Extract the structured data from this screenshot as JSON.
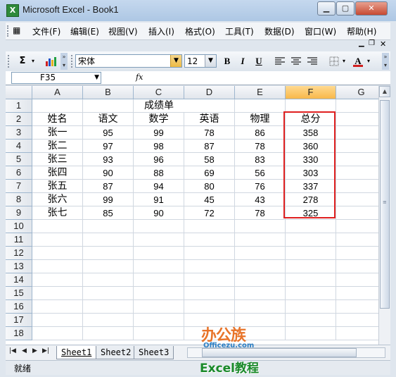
{
  "window": {
    "title": "Microsoft Excel - Book1"
  },
  "menu": [
    "文件(F)",
    "编辑(E)",
    "视图(V)",
    "插入(I)",
    "格式(O)",
    "工具(T)",
    "数据(D)",
    "窗口(W)",
    "帮助(H)"
  ],
  "toolbar": {
    "sum_symbol": "Σ",
    "font_name": "宋体",
    "font_size": "12",
    "bold": "B",
    "italic": "I",
    "underline": "U",
    "font_color_label": "A",
    "font_color": "#d11f1f"
  },
  "formula_bar": {
    "name_box": "F35",
    "fx_label": "fx",
    "content": ""
  },
  "sheet": {
    "columns": [
      "A",
      "B",
      "C",
      "D",
      "E",
      "F",
      "G"
    ],
    "selected_column": "F",
    "rows": [
      "1",
      "2",
      "3",
      "4",
      "5",
      "6",
      "7",
      "8",
      "9",
      "10",
      "11",
      "12",
      "13",
      "14",
      "15",
      "16",
      "17",
      "18"
    ],
    "title": "成绩单",
    "headers": [
      "姓名",
      "语文",
      "数学",
      "英语",
      "物理",
      "总分"
    ],
    "data": [
      [
        "张一",
        "95",
        "99",
        "78",
        "86",
        "358"
      ],
      [
        "张二",
        "97",
        "98",
        "87",
        "78",
        "360"
      ],
      [
        "张三",
        "93",
        "96",
        "58",
        "83",
        "330"
      ],
      [
        "张四",
        "90",
        "88",
        "69",
        "56",
        "303"
      ],
      [
        "张五",
        "87",
        "94",
        "80",
        "76",
        "337"
      ],
      [
        "张六",
        "99",
        "91",
        "45",
        "43",
        "278"
      ],
      [
        "张七",
        "85",
        "90",
        "72",
        "78",
        "325"
      ]
    ],
    "highlight_color": "#e02020"
  },
  "tabs": [
    "Sheet1",
    "Sheet2",
    "Sheet3"
  ],
  "active_tab": "Sheet1",
  "status": {
    "text": "就绪"
  },
  "watermark": {
    "line1": "办公族",
    "line2": "Officezu.com",
    "line3": "Excel教程"
  }
}
